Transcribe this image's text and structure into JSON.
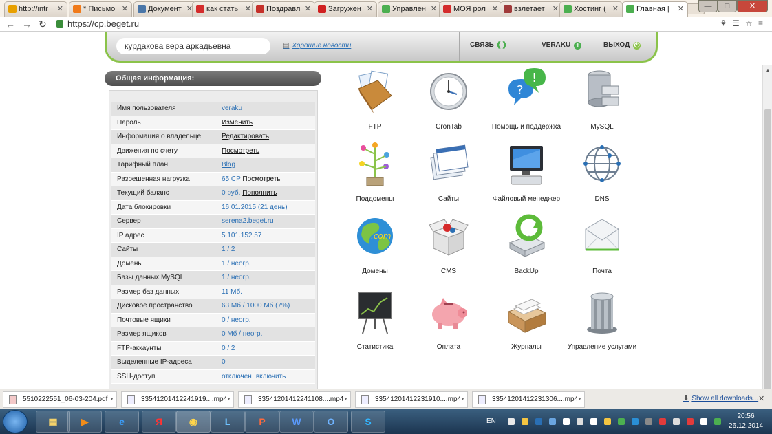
{
  "browser": {
    "tabs": [
      {
        "title": "http://intr",
        "color": "#e8a000"
      },
      {
        "title": "* Письмо",
        "color": "#f07a1a"
      },
      {
        "title": "Документ",
        "color": "#4a76a8"
      },
      {
        "title": "как стать",
        "color": "#d42c2c"
      },
      {
        "title": "Поздравл",
        "color": "#c5312a"
      },
      {
        "title": "Загружен",
        "color": "#d02020"
      },
      {
        "title": "Управлен",
        "color": "#4caf50"
      },
      {
        "title": "МОЯ рол",
        "color": "#d42c2c"
      },
      {
        "title": "взлетает",
        "color": "#a03a3a"
      },
      {
        "title": "Хостинг (",
        "color": "#4caf50"
      },
      {
        "title": "Главная |",
        "color": "#4caf50"
      }
    ],
    "url": "https://cp.beget.ru"
  },
  "header": {
    "user_name": "курдакова вера аркадьевна",
    "news_link": "Хорошие новости",
    "contact_label": "СВЯЗЬ",
    "account_label": "VERAKU",
    "logout_label": "ВЫХОД"
  },
  "info_panel": {
    "title": "Общая информация:",
    "rows": [
      {
        "label": "Имя пользователя",
        "value": "veraku"
      },
      {
        "label": "Пароль",
        "link": "Изменить"
      },
      {
        "label": "Информация о владельце",
        "link": "Редактировать"
      },
      {
        "label": "Движения по счету",
        "link": "Посмотреть"
      },
      {
        "label": "Тарифный план",
        "tag": "Blog"
      },
      {
        "label": "Разрешенная нагрузка",
        "value": "65 CP",
        "link": "Посмотреть"
      },
      {
        "label": "Текущий баланс",
        "value": "0 руб.",
        "link": "Пополнить"
      },
      {
        "label": "Дата блокировки",
        "value": "16.01.2015 (21 день)"
      },
      {
        "label": "Сервер",
        "value": "serena2.beget.ru"
      },
      {
        "label": "IP адрес",
        "value": "5.101.152.57"
      },
      {
        "label": "Сайты",
        "value": "1 / 2"
      },
      {
        "label": "Домены",
        "value": "1 / неогр."
      },
      {
        "label": "Базы данных MySQL",
        "value": "1 / неогр."
      },
      {
        "label": "Размер баз данных",
        "value": "11 Мб."
      },
      {
        "label": "Дисковое пространство",
        "value": "63 Мб / 1000 Мб (7%)"
      },
      {
        "label": "Почтовые ящики",
        "value": "0 / неогр."
      },
      {
        "label": "Размер ящиков",
        "value": "0 Мб / неогр."
      },
      {
        "label": "FTP-аккаунты",
        "value": "0 / 2"
      },
      {
        "label": "Выделенные IP-адреса",
        "value": "0"
      },
      {
        "label": "SSH-доступ",
        "value": "отключен",
        "link2": "включить"
      }
    ]
  },
  "services": [
    {
      "label": "FTP",
      "icon": "ftp-folder-icon"
    },
    {
      "label": "CronTab",
      "icon": "clock-icon"
    },
    {
      "label": "Помощь и поддержка",
      "icon": "help-bubbles-icon"
    },
    {
      "label": "MySQL",
      "icon": "database-cabinet-icon"
    },
    {
      "label": "Поддомены",
      "icon": "tree-icon"
    },
    {
      "label": "Сайты",
      "icon": "browser-windows-icon"
    },
    {
      "label": "Файловый менеджер",
      "icon": "computer-icon"
    },
    {
      "label": "DNS",
      "icon": "globe-wireframe-icon"
    },
    {
      "label": "Домены",
      "icon": "globe-icon"
    },
    {
      "label": "CMS",
      "icon": "box-icon"
    },
    {
      "label": "BackUp",
      "icon": "drive-backup-icon"
    },
    {
      "label": "Почта",
      "icon": "envelope-icon"
    },
    {
      "label": "Статистика",
      "icon": "chart-board-icon"
    },
    {
      "label": "Оплата",
      "icon": "piggy-bank-icon"
    },
    {
      "label": "Журналы",
      "icon": "logs-box-icon"
    },
    {
      "label": "Управление услугами",
      "icon": "control-cylinder-icon"
    }
  ],
  "downloads": {
    "items": [
      "5510222551_06-03-204.pdf",
      "33541201412241919....mp4",
      "33541201412241108....mp4",
      "33541201412231910....mp4",
      "33541201412231306....mp4"
    ],
    "show_all": "Show all downloads..."
  },
  "taskbar": {
    "lang": "EN",
    "time": "20:56",
    "date": "26.12.2014"
  }
}
